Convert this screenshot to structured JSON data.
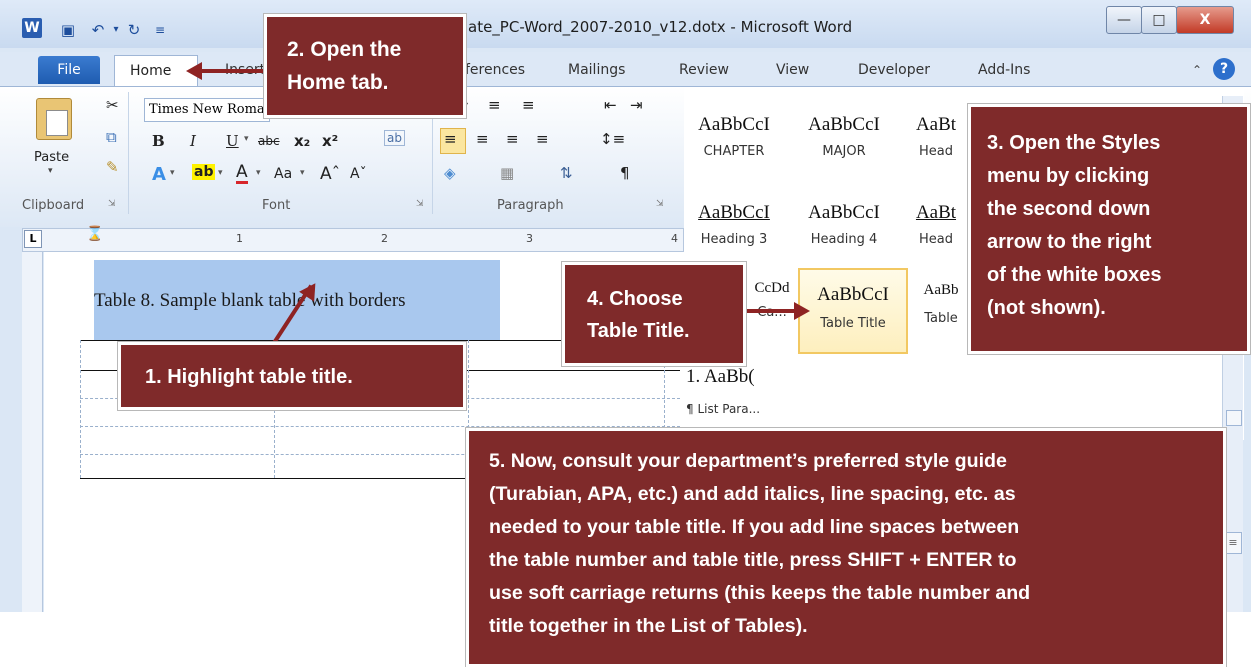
{
  "window": {
    "title": "ate_PC-Word_2007-2010_v12.dotx - Microsoft Word",
    "app_icon_letter": "W"
  },
  "tabs": [
    {
      "label": "File"
    },
    {
      "label": "Home"
    },
    {
      "label": "Insert"
    },
    {
      "label": "ferences"
    },
    {
      "label": "Mailings"
    },
    {
      "label": "Review"
    },
    {
      "label": "View"
    },
    {
      "label": "Developer"
    },
    {
      "label": "Add-Ins"
    }
  ],
  "ribbon": {
    "paste_label": "Paste",
    "font_name": "Times New Roman",
    "group_clipboard": "Clipboard",
    "group_font": "Font",
    "group_paragraph": "Paragraph"
  },
  "styles": [
    {
      "sample": "AaBbCcI",
      "name": "CHAPTER"
    },
    {
      "sample": "AaBbCcI",
      "name": "MAJOR"
    },
    {
      "sample": "AaBt",
      "name": "Head"
    },
    {
      "sample": "AaBbCcI",
      "name": "Heading 3"
    },
    {
      "sample": "AaBbCcI",
      "name": "Heading 4"
    },
    {
      "sample": "AaBt",
      "name": "Head"
    },
    {
      "sample": "CcDd",
      "name": "Ca..."
    },
    {
      "sample": "AaBbCcI",
      "name": "Table Title"
    },
    {
      "sample": "AaBb",
      "name": "Table"
    },
    {
      "sample": "1. AaBb(",
      "name": "¶ List Para..."
    }
  ],
  "document": {
    "table_title": "Table 8. Sample blank table with borders"
  },
  "ruler": {
    "marks": [
      "1",
      "2",
      "3",
      "4"
    ]
  },
  "callouts": {
    "c1": "1. Highlight table title.",
    "c2_line1": "2. Open the",
    "c2_line2": "Home tab.",
    "c3_lines": [
      "3. Open the Styles",
      "menu by clicking",
      "the second down",
      "arrow to the right",
      "of the white boxes",
      "(not shown)."
    ],
    "c4_line1": "4. Choose",
    "c4_line2": "Table Title.",
    "c5_lines": [
      "5. Now, consult your department’s preferred style guide",
      "(Turabian, APA, etc.) and add italics, line spacing, etc. as",
      "needed to your table title. If you add line spaces between",
      "the table number and table title, press SHIFT + ENTER to",
      "use soft carriage returns (this keeps the table number and",
      "title together in the List of Tables)."
    ]
  },
  "colors": {
    "callout_bg": "#7f2a2a",
    "arrow": "#8e2323",
    "highlight": "#a9c8ee"
  }
}
